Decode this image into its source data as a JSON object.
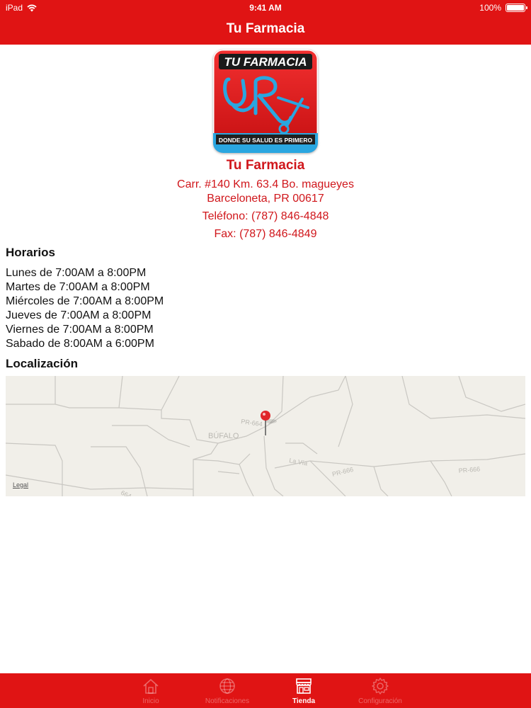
{
  "status_bar": {
    "carrier": "iPad",
    "time": "9:41 AM",
    "battery": "100%"
  },
  "header": {
    "title": "Tu Farmacia"
  },
  "logo": {
    "brand_text": "TU FARMACIA",
    "tagline": "DONDE SU SALUD ES PRIMERO",
    "colors": {
      "background": "#e01414",
      "accent": "#2aa6e0"
    }
  },
  "store": {
    "name": "Tu Farmacia",
    "address_line1": "Carr. #140 Km. 63.4 Bo. magueyes",
    "address_line2": "Barceloneta, PR 00617",
    "phone": "Teléfono: (787) 846-4848",
    "fax": "Fax: (787) 846-4849"
  },
  "hours_section": {
    "title": "Horarios",
    "lines": [
      "Lunes de 7:00AM a 8:00PM",
      "Martes de 7:00AM a 8:00PM",
      "Miércoles de 7:00AM a 8:00PM",
      "Jueves de 7:00AM a 8:00PM",
      "Viernes de 7:00AM a 8:00PM",
      "Sabado de 8:00AM a 6:00PM"
    ]
  },
  "location_section": {
    "title": "Localización"
  },
  "map": {
    "labels": {
      "town": "BÚFALO",
      "road_a": "PR-664",
      "road_b": "La Vía",
      "road_c": "PR-666",
      "road_d": "PR-666",
      "road_e": "664"
    },
    "legal": "Legal"
  },
  "tabbar": {
    "tabs": [
      {
        "label": "Inicio",
        "icon": "home-icon",
        "active": false
      },
      {
        "label": "Notificaciones",
        "icon": "globe-icon",
        "active": false
      },
      {
        "label": "Tienda",
        "icon": "store-icon",
        "active": true
      },
      {
        "label": "Configuración",
        "icon": "gear-icon",
        "active": false
      }
    ]
  },
  "colors": {
    "brand_red": "#e01414",
    "text_red": "#d0161b"
  }
}
